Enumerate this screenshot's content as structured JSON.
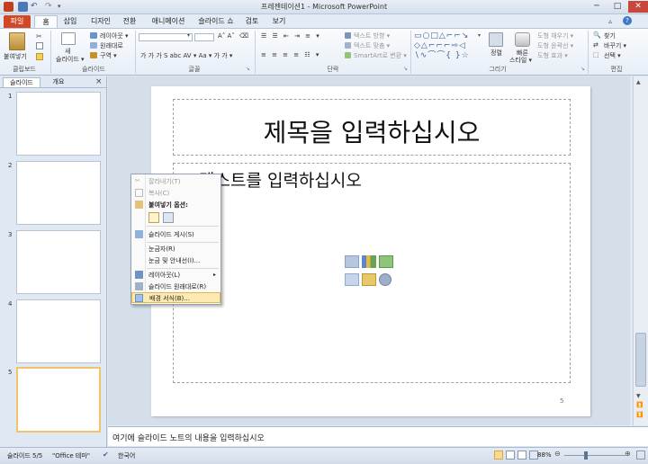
{
  "window": {
    "title": "프레젠테이션1 - Microsoft PowerPoint",
    "minimize": "─",
    "maximize": "□",
    "close": "✕"
  },
  "tabs": [
    "파일",
    "홈",
    "삽입",
    "디자인",
    "전환",
    "애니메이션",
    "슬라이드 쇼",
    "검토",
    "보기"
  ],
  "ribbon": {
    "clipboard": {
      "paste": "붙여넣기",
      "label": "클립보드"
    },
    "slides": {
      "new_slide": "새",
      "new_slide2": "슬라이드 ▾",
      "layout": "레이아웃 ▾",
      "reset": "원래대로",
      "section": "구역 ▾",
      "label": "슬라이드"
    },
    "font": {
      "label": "글꼴",
      "row2": "가 가  가 가 ▾",
      "row3": "가 가 가 S abc AV ▾ Aa ▾ 가 가 ▾"
    },
    "paragraph": {
      "label": "단락",
      "text_direction": "텍스트 방향 ▾",
      "align_text": "텍스트 맞춤 ▾",
      "smartart": "SmartArt로 변환 ▾"
    },
    "drawing": {
      "arrange": "정렬",
      "quick_styles": "빠른",
      "quick_styles2": "스타일 ▾",
      "fill": "도형 채우기 ▾",
      "outline": "도형 윤곽선 ▾",
      "effects": "도형 효과 ▾",
      "label": "그리기"
    },
    "editing": {
      "find": "찾기",
      "replace": "바꾸기 ▾",
      "select": "선택 ▾",
      "label": "편집"
    }
  },
  "left_pane": {
    "tab_slides": "슬라이드",
    "tab_outline": "개요",
    "close": "×",
    "thumbnails": [
      "1",
      "2",
      "3",
      "4",
      "5"
    ]
  },
  "slide": {
    "title": "제목을 입력하십시오",
    "body": "텍스트를 입력하십시오",
    "number": "5"
  },
  "notes": {
    "placeholder": "여기에 슬라이드 노트의 내용을 입력하십시오"
  },
  "status": {
    "slide_info": "슬라이드 5/5",
    "theme": "\"Office 테마\"",
    "language": "한국어",
    "zoom": "88%"
  },
  "context_menu": {
    "cut": "잘라내기(T)",
    "copy": "복사(C)",
    "paste_options": "붙여넣기 옵션:",
    "new_slide": "슬라이드 게시(S)",
    "ruler": "눈금자(R)",
    "grid_guides": "눈금 및 안내선(I)...",
    "layout": "레이아웃(L)",
    "reset_slide": "슬라이드 원래대로(R)",
    "format_background": "배경 서식(B)..."
  }
}
